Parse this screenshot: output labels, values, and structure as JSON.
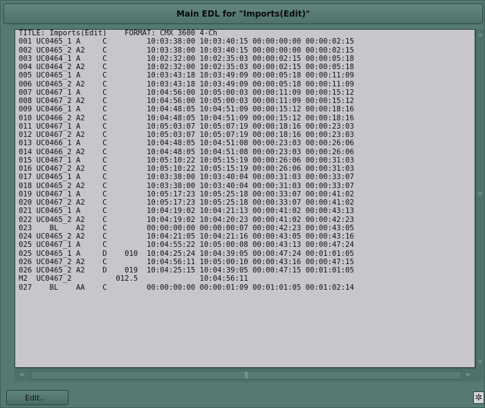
{
  "window": {
    "title": "Main EDL for \"Imports(Edit)\""
  },
  "edl": {
    "lines": [
      "TITLE: Imports(Edit)    FORMAT: CMX 3600 4-Ch",
      "001 UC0465_1 A     C         10:03:38:00 10:03:40:15 00:00:00:00 00:00:02:15",
      "002 UC0465_2 A2    C         10:03:38:00 10:03:40:15 00:00:00:00 00:00:02:15",
      "003 UC0464_1 A     C         10:02:32:00 10:02:35:03 00:00:02:15 00:00:05:18",
      "004 UC0464_2 A2    C         10:02:32:00 10:02:35:03 00:00:02:15 00:00:05:18",
      "005 UC0465_1 A     C         10:03:43:18 10:03:49:09 00:00:05:18 00:00:11:09",
      "006 UC0465_2 A2    C         10:03:43:18 10:03:49:09 00:00:05:18 00:00:11:09",
      "007 UC0467_1 A     C         10:04:56:00 10:05:00:03 00:00:11:09 00:00:15:12",
      "008 UC0467_2 A2    C         10:04:56:00 10:05:00:03 00:00:11:09 00:00:15:12",
      "009 UC0466_1 A     C         10:04:48:05 10:04:51:09 00:00:15:12 00:00:18:16",
      "010 UC0466_2 A2    C         10:04:48:05 10:04:51:09 00:00:15:12 00:00:18:16",
      "011 UC0467_1 A     C         10:05:03:07 10:05:07:19 00:00:18:16 00:00:23:03",
      "012 UC0467_2 A2    C         10:05:03:07 10:05:07:19 00:00:18:16 00:00:23:03",
      "013 UC0466_1 A     C         10:04:48:05 10:04:51:08 00:00:23:03 00:00:26:06",
      "014 UC0466_2 A2    C         10:04:48:05 10:04:51:08 00:00:23:03 00:00:26:06",
      "015 UC0467_1 A     C         10:05:10:22 10:05:15:19 00:00:26:06 00:00:31:03",
      "016 UC0467_2 A2    C         10:05:10:22 10:05:15:19 00:00:26:06 00:00:31:03",
      "017 UC0465_1 A     C         10:03:38:00 10:03:40:04 00:00:31:03 00:00:33:07",
      "018 UC0465_2 A2    C         10:03:38:00 10:03:40:04 00:00:31:03 00:00:33:07",
      "019 UC0467_1 A     C         10:05:17:23 10:05:25:18 00:00:33:07 00:00:41:02",
      "020 UC0467_2 A2    C         10:05:17:23 10:05:25:18 00:00:33:07 00:00:41:02",
      "021 UC0465_1 A     C         10:04:19:02 10:04:21:13 00:00:41:02 00:00:43:13",
      "022 UC0465_2 A2    C         10:04:19:02 10:04:20:23 00:00:41:02 00:00:42:23",
      "023    BL    A2    C         00:00:00:00 00:00:00:07 00:00:42:23 00:00:43:05",
      "024 UC0465_2 A2    C         10:04:21:05 10:04:21:16 00:00:43:05 00:00:43:16",
      "025 UC0467_1 A     C         10:04:55:22 10:05:00:08 00:00:43:13 00:00:47:24",
      "025 UC0465_1 A     D    010  10:04:25:24 10:04:39:05 00:00:47:24 00:01:01:05",
      "026 UC0467_2 A2    C         10:04:56:11 10:05:00:10 00:00:43:16 00:00:47:15",
      "026 UC0465_2 A2    D    019  10:04:25:15 10:04:39:05 00:00:47:15 00:01:01:05",
      "M2  UC0467_2          012.5              10:04:56:11",
      "027    BL    AA    C         00:00:00:00 00:00:01:09 00:01:01:05 00:01:02:14"
    ]
  },
  "footer": {
    "edit_label": "Edit..",
    "corner_glyph": "✲"
  },
  "icons": {
    "scroll_up": "▲",
    "scroll_down": "▼",
    "scroll_left": "◀",
    "scroll_right": "▶"
  }
}
